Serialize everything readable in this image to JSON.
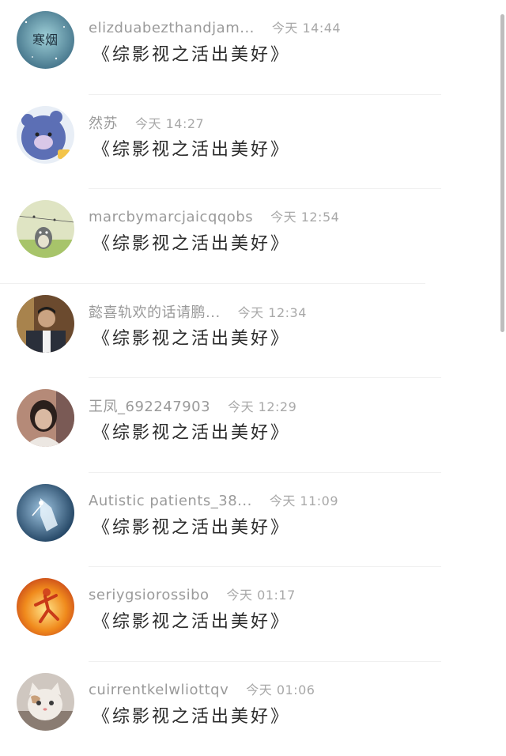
{
  "messages": [
    {
      "name": "elizduabezthandjam...",
      "time": "今天 14:44",
      "text": "《综影视之活出美好》",
      "avatar": "text-avatar",
      "avatar_text": "寒烟"
    },
    {
      "name": "然苏",
      "time": "今天 14:27",
      "text": "《综影视之活出美好》",
      "avatar": "bear-avatar"
    },
    {
      "name": "marcbymarcjaicqqobs",
      "time": "今天 12:54",
      "text": "《综影视之活出美好》",
      "avatar": "totoro-avatar"
    },
    {
      "name": "懿喜轨欢的话请鹏...",
      "time": "今天 12:34",
      "text": "《综影视之活出美好》",
      "avatar": "man-avatar"
    },
    {
      "name": "王凤_692247903",
      "time": "今天 12:29",
      "text": "《综影视之活出美好》",
      "avatar": "woman-avatar"
    },
    {
      "name": "Autistic patients_38...",
      "time": "今天 11:09",
      "text": "《综影视之活出美好》",
      "avatar": "dancer-avatar"
    },
    {
      "name": "seriygsiorossibo",
      "time": "今天 01:17",
      "text": "《综影视之活出美好》",
      "avatar": "runner-avatar"
    },
    {
      "name": "cuirrentkelwliottqv",
      "time": "今天 01:06",
      "text": "《综影视之活出美好》",
      "avatar": "cat-avatar"
    }
  ]
}
